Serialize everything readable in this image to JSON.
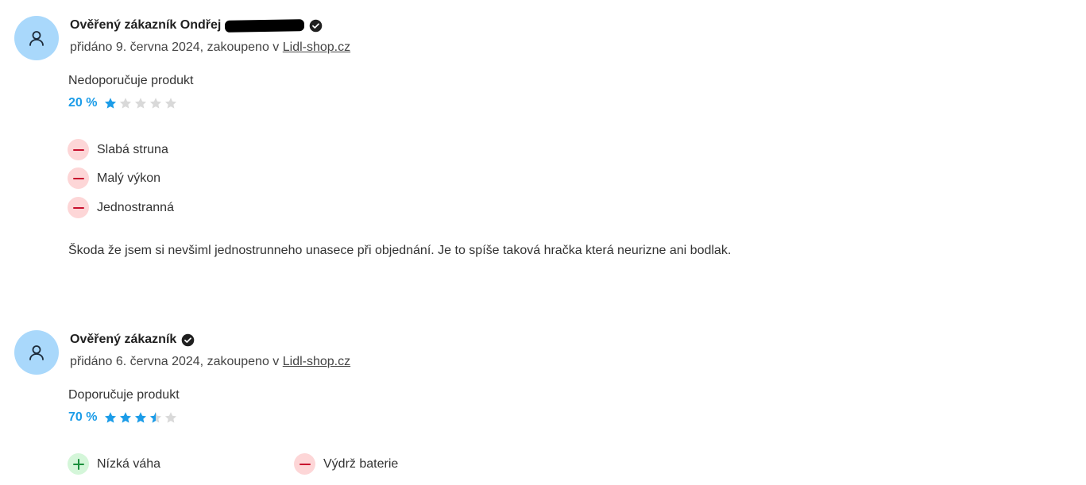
{
  "reviews": [
    {
      "author": "Ověřený zákazník Ondřej",
      "meta_prefix": "přidáno 9. června 2024, zakoupeno v ",
      "shop_link": "Lidl-shop.cz",
      "recommendation": "Nedoporučuje produkt",
      "rating_percent": "20 %",
      "rating_stars": 1,
      "features": [
        {
          "type": "negative",
          "label": "Slabá struna"
        },
        {
          "type": "negative",
          "label": "Malý výkon"
        },
        {
          "type": "negative",
          "label": "Jednostranná"
        }
      ],
      "text": "Škoda že jsem si nevšiml jednostrunneho unasece při objednání. Je to spíše taková hračka která neurizne ani bodlak."
    },
    {
      "author": "Ověřený zákazník",
      "meta_prefix": "přidáno 6. června 2024, zakoupeno v ",
      "shop_link": "Lidl-shop.cz",
      "recommendation": "Doporučuje produkt",
      "rating_percent": "70 %",
      "rating_stars": 3.5,
      "features": [
        {
          "type": "positive",
          "label": "Nízká váha"
        },
        {
          "type": "negative",
          "label": "Výdrž baterie"
        }
      ]
    }
  ],
  "icons": {
    "avatar": "user-icon",
    "verified": "verified-check-icon",
    "star": "star-icon",
    "minus": "minus-icon",
    "plus": "plus-icon"
  },
  "colors": {
    "avatar_bg": "#a9d8fb",
    "star_filled": "#1b9ce8",
    "star_empty": "#d9d9d9",
    "negative_badge": "#fdd6d7",
    "negative_mark": "#c8102e",
    "positive_badge": "#d4f6d9",
    "positive_mark": "#1a8f3c"
  }
}
